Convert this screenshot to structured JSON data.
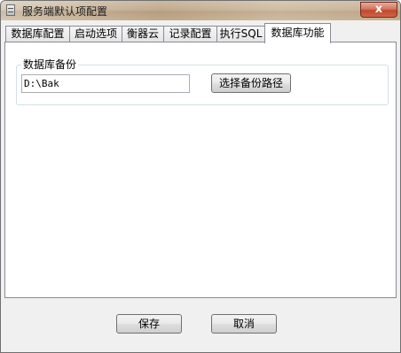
{
  "window": {
    "title": "服务端默认项配置",
    "close_glyph": "x"
  },
  "tabs": [
    {
      "label": "数据库配置",
      "active": false
    },
    {
      "label": "启动选项",
      "active": false
    },
    {
      "label": "衡器云",
      "active": false
    },
    {
      "label": "记录配置",
      "active": false
    },
    {
      "label": "执行SQL",
      "active": false
    },
    {
      "label": "数据库功能",
      "active": true
    }
  ],
  "backup": {
    "group_title": "数据库备份",
    "path_value": "D:\\Bak",
    "browse_label": "选择备份路径"
  },
  "footer": {
    "save_label": "保存",
    "cancel_label": "取消"
  }
}
